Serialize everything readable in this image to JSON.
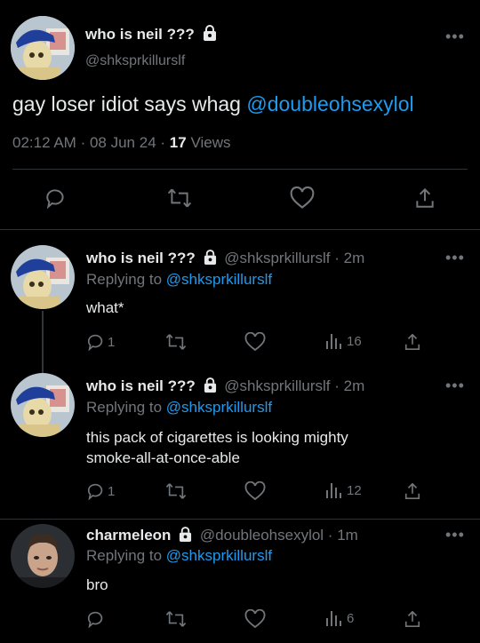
{
  "main_tweet": {
    "display_name": "who is neil ???",
    "handle": "@shksprkillurslf",
    "text": "gay loser idiot says whag",
    "mention": "@doubleohsexylol",
    "time": "02:12 AM",
    "dot1": "·",
    "date": "08 Jun 24",
    "dot2": "·",
    "views_count": "17",
    "views_label": "Views"
  },
  "replies": [
    {
      "display_name": "who is neil ???",
      "meta": "@shksprkillurslf · 2m",
      "replying_prefix": "Replying to",
      "replying_handle": "@shksprkillurslf",
      "text_line1": "what*",
      "text_line2": "",
      "reply_count": "1",
      "views": "16"
    },
    {
      "display_name": "who is neil ???",
      "meta": "@shksprkillurslf · 2m",
      "replying_prefix": "Replying to",
      "replying_handle": "@shksprkillurslf",
      "text_line1": "this pack of cigarettes is looking mighty",
      "text_line2": "smoke-all-at-once-able",
      "reply_count": "1",
      "views": "12"
    },
    {
      "display_name": "charmeleon",
      "meta": "@doubleohsexylol · 1m",
      "replying_prefix": "Replying to",
      "replying_handle": "@shksprkillurslf",
      "text_line1": "bro",
      "text_line2": "",
      "reply_count": "",
      "views": "6"
    }
  ],
  "icons": {
    "more": "more-dots-icon",
    "lock": "lock-icon",
    "reply": "reply-icon",
    "retweet": "retweet-icon",
    "like": "heart-icon",
    "views": "views-bars-icon",
    "share": "share-icon"
  },
  "colors": {
    "background": "#000000",
    "text": "#e7e9ea",
    "muted": "#71767b",
    "link": "#1d9bf0",
    "divider": "#2f3336"
  }
}
